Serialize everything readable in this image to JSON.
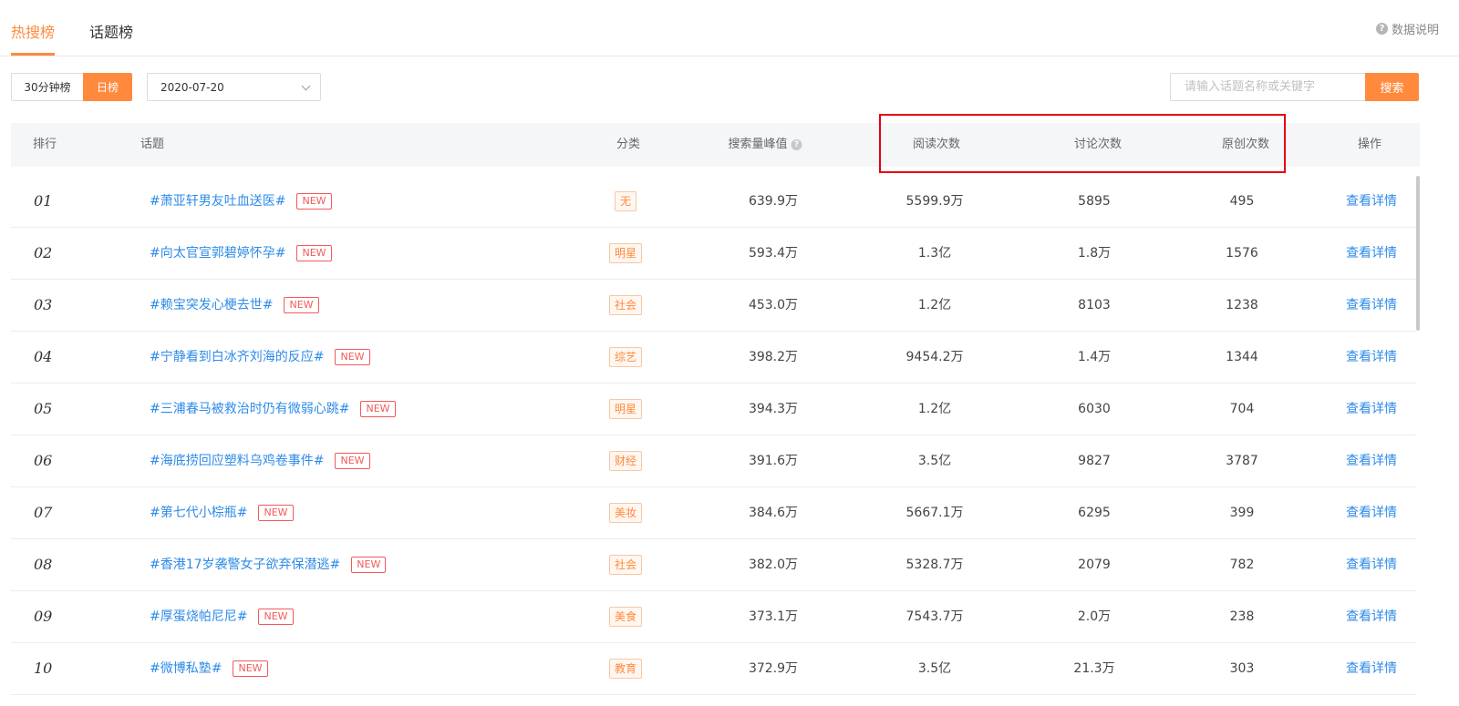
{
  "tabs": [
    {
      "label": "热搜榜",
      "active": true
    },
    {
      "label": "话题榜",
      "active": false
    }
  ],
  "help": {
    "icon": "question-circle-icon",
    "label": "数据说明"
  },
  "toolbar": {
    "toggle": [
      "30分钟榜",
      "日榜"
    ],
    "toggle_active": "日榜",
    "date_value": "2020-07-20",
    "search_placeholder": "请输入话题名称或关键字",
    "search_button": "搜索"
  },
  "colors": {
    "accent": "#ff8a3d",
    "link": "#2e8be8",
    "badge_red": "#f15a5a",
    "highlight_box": "#e60012"
  },
  "table": {
    "headers": {
      "rank": "排行",
      "topic": "话题",
      "category": "分类",
      "search_peak": "搜索量峰值",
      "reads": "阅读次数",
      "discussions": "讨论次数",
      "originals": "原创次数",
      "action": "操作"
    },
    "rows": [
      {
        "rank": "01",
        "topic": "#萧亚轩男友吐血送医#",
        "badge": "NEW",
        "category": "无",
        "search_peak": "639.9万",
        "reads": "5599.9万",
        "discussions": "5895",
        "originals": "495",
        "action": "查看详情"
      },
      {
        "rank": "02",
        "topic": "#向太官宣郭碧婷怀孕#",
        "badge": "NEW",
        "category": "明星",
        "search_peak": "593.4万",
        "reads": "1.3亿",
        "discussions": "1.8万",
        "originals": "1576",
        "action": "查看详情"
      },
      {
        "rank": "03",
        "topic": "#赖宝突发心梗去世#",
        "badge": "NEW",
        "category": "社会",
        "search_peak": "453.0万",
        "reads": "1.2亿",
        "discussions": "8103",
        "originals": "1238",
        "action": "查看详情"
      },
      {
        "rank": "04",
        "topic": "#宁静看到白冰齐刘海的反应#",
        "badge": "NEW",
        "category": "综艺",
        "search_peak": "398.2万",
        "reads": "9454.2万",
        "discussions": "1.4万",
        "originals": "1344",
        "action": "查看详情"
      },
      {
        "rank": "05",
        "topic": "#三浦春马被救治时仍有微弱心跳#",
        "badge": "NEW",
        "category": "明星",
        "search_peak": "394.3万",
        "reads": "1.2亿",
        "discussions": "6030",
        "originals": "704",
        "action": "查看详情"
      },
      {
        "rank": "06",
        "topic": "#海底捞回应塑料乌鸡卷事件#",
        "badge": "NEW",
        "category": "财经",
        "search_peak": "391.6万",
        "reads": "3.5亿",
        "discussions": "9827",
        "originals": "3787",
        "action": "查看详情"
      },
      {
        "rank": "07",
        "topic": "#第七代小棕瓶#",
        "badge": "NEW",
        "category": "美妆",
        "search_peak": "384.6万",
        "reads": "5667.1万",
        "discussions": "6295",
        "originals": "399",
        "action": "查看详情"
      },
      {
        "rank": "08",
        "topic": "#香港17岁袭警女子欲弃保潜逃#",
        "badge": "NEW",
        "category": "社会",
        "search_peak": "382.0万",
        "reads": "5328.7万",
        "discussions": "2079",
        "originals": "782",
        "action": "查看详情"
      },
      {
        "rank": "09",
        "topic": "#厚蛋烧帕尼尼#",
        "badge": "NEW",
        "category": "美食",
        "search_peak": "373.1万",
        "reads": "7543.7万",
        "discussions": "2.0万",
        "originals": "238",
        "action": "查看详情"
      },
      {
        "rank": "10",
        "topic": "#微博私塾#",
        "badge": "NEW",
        "category": "教育",
        "search_peak": "372.9万",
        "reads": "3.5亿",
        "discussions": "21.3万",
        "originals": "303",
        "action": "查看详情"
      }
    ]
  }
}
